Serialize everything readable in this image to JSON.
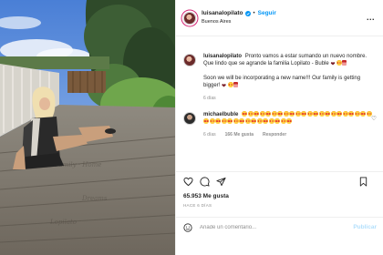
{
  "header": {
    "username": "luisanalopilato",
    "separator": "•",
    "follow_label": "Seguir",
    "location": "Buenos Aires",
    "more_glyph": "..."
  },
  "caption": {
    "username": "luisanalopilato",
    "text_es": "Pronto vamos a estar sumando un nuevo nombre. Que lindo que se agrande la familia Lopilato - Buble",
    "text_en": "Soon we will be incorporating a new name!!! Our family is getting bigger!",
    "time": "6 días"
  },
  "comment": {
    "username": "michaelbuble",
    "emoji_count": 37,
    "time": "6 días",
    "likes": "166 Me gusta",
    "reply_label": "Responder"
  },
  "post": {
    "likes_text": "65.953 Me gusta",
    "posted_ago": "HACE 6 DÍAS"
  },
  "add_comment": {
    "placeholder": "Añade un comentario...",
    "publish_label": "Publicar"
  },
  "colors": {
    "accent": "#0095f6",
    "publish_disabled": "#b2dffc",
    "muted": "#8e8e8e",
    "text": "#262626"
  }
}
